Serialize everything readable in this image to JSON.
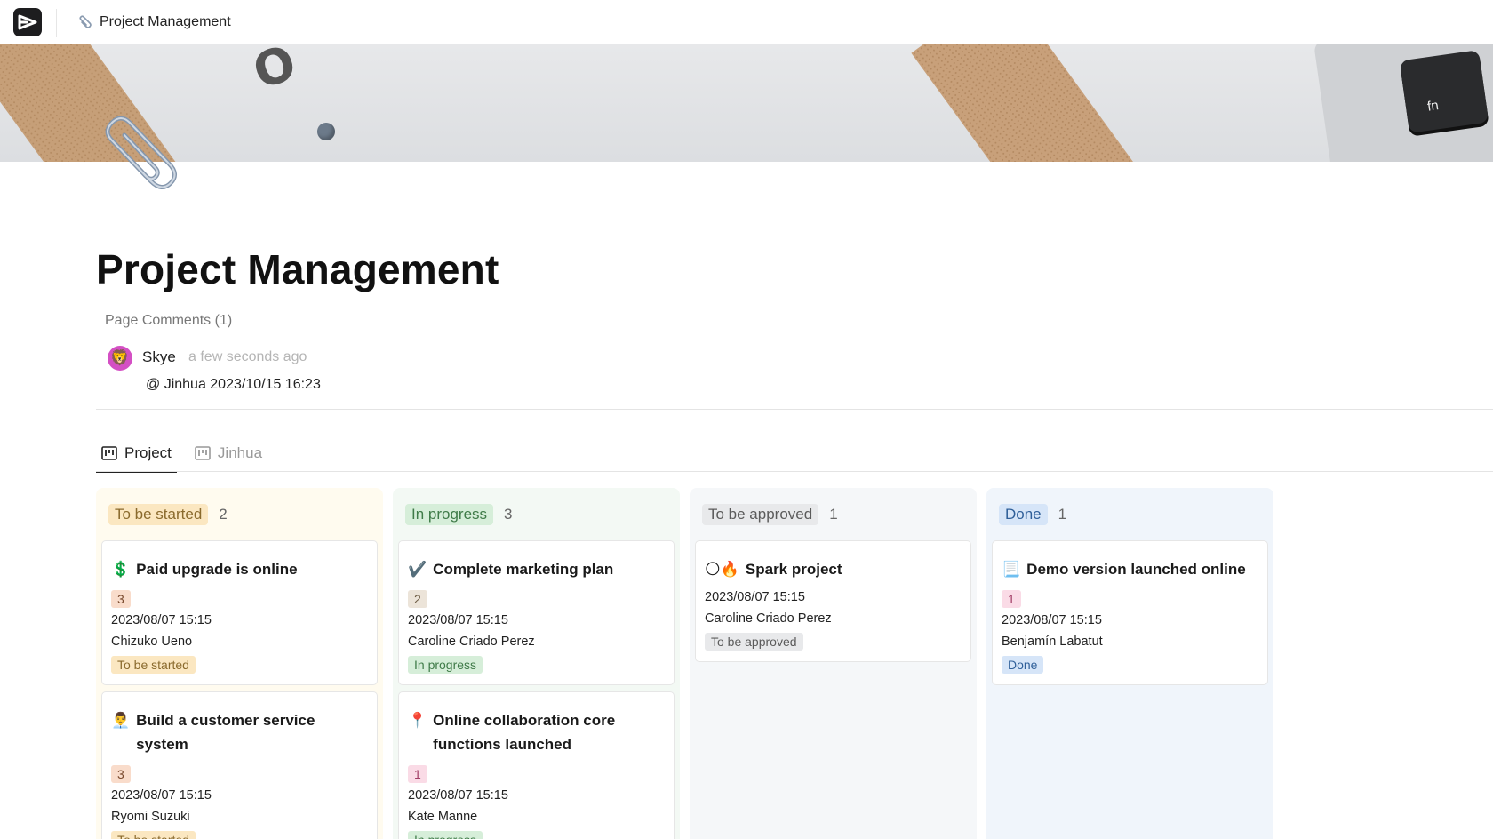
{
  "topbar": {
    "title": "Project Management"
  },
  "cover": {
    "key_label": "fn"
  },
  "page": {
    "title": "Project Management"
  },
  "comments": {
    "label": "Page Comments (1)",
    "items": [
      {
        "author": "Skye",
        "time": "a few seconds ago",
        "text": "@ Jinhua 2023/10/15 16:23",
        "avatar_emoji": "🦁"
      }
    ]
  },
  "tabs": [
    {
      "label": "Project",
      "active": true,
      "icon": "kanban-icon"
    },
    {
      "label": "Jinhua",
      "active": false,
      "icon": "kanban-icon"
    }
  ],
  "columns": [
    {
      "status": "To be started",
      "count": "2",
      "color": "#fbe7c1",
      "cards": [
        {
          "emoji": "💲",
          "title": "Paid upgrade is online",
          "priority": "3",
          "date": "2023/08/07 15:15",
          "person": "Chizuko Ueno",
          "status": "To be started"
        },
        {
          "emoji": "👨‍💼",
          "title": "Build a customer service system",
          "priority": "3",
          "date": "2023/08/07 15:15",
          "person": "Ryomi Suzuki",
          "status": "To be started"
        }
      ]
    },
    {
      "status": "In progress",
      "count": "3",
      "color": "#d6eed9",
      "cards": [
        {
          "emoji": "✔️",
          "title": "Complete marketing plan",
          "priority": "2",
          "date": "2023/08/07 15:15",
          "person": "Caroline Criado Perez",
          "status": "In progress"
        },
        {
          "emoji": "📍",
          "title": "Online collaboration core functions launched",
          "priority": "1",
          "date": "2023/08/07 15:15",
          "person": "Kate Manne",
          "status": "In progress"
        }
      ]
    },
    {
      "status": "To be approved",
      "count": "1",
      "color": "#e8e9eb",
      "cards": [
        {
          "emoji": "🌕🔥",
          "title": "Spark project",
          "date": "2023/08/07 15:15",
          "person": "Caroline Criado Perez",
          "status": "To be approved"
        }
      ]
    },
    {
      "status": "Done",
      "count": "1",
      "color": "#d6e5f8",
      "cards": [
        {
          "emoji": "📃",
          "title": "Demo version launched online",
          "priority": "1",
          "date": "2023/08/07 15:15",
          "person": "Benjamín Labatut",
          "status": "Done"
        }
      ]
    }
  ]
}
